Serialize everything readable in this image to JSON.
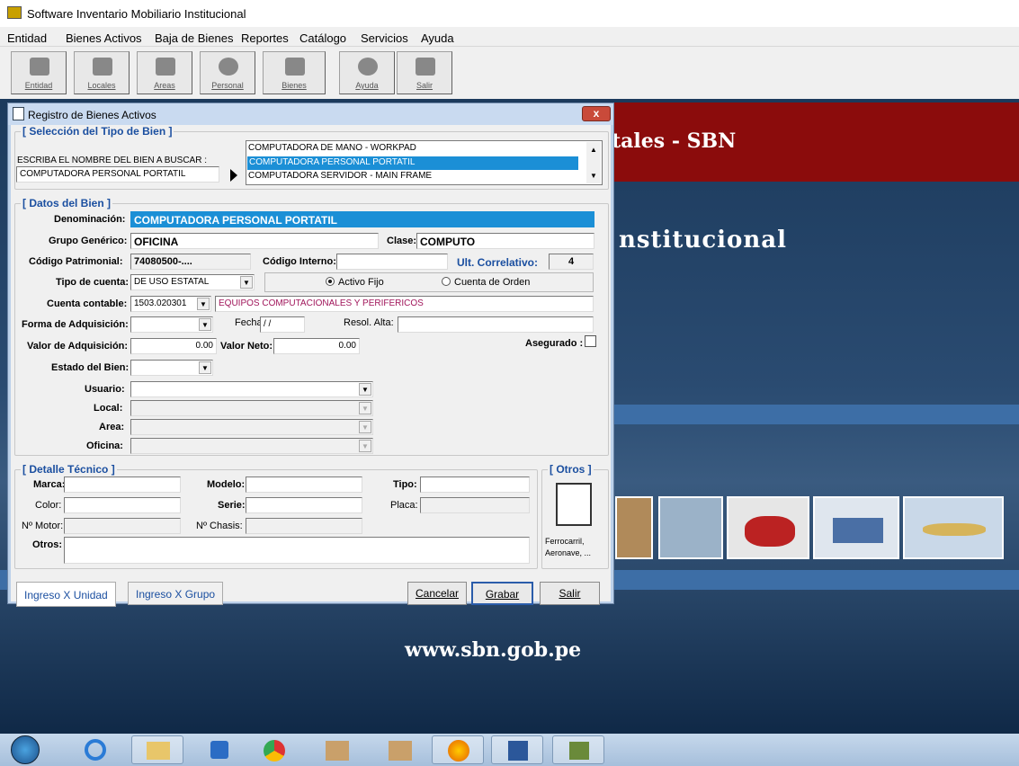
{
  "app": {
    "title": "Software Inventario Mobiliario Institucional"
  },
  "menu": [
    "Entidad",
    "Bienes Activos",
    "Baja de Bienes",
    "Reportes",
    "Catálogo",
    "Servicios",
    "Ayuda"
  ],
  "toolbar": [
    "Entidad",
    "Locales",
    "Areas",
    "Personal",
    "Bienes",
    "Ayuda",
    "Salir"
  ],
  "background": {
    "banner_title": "tales - SBN",
    "subtitle": "nstitucional",
    "url": "www.sbn.gob.pe"
  },
  "dialog": {
    "title": "Registro de Bienes Activos",
    "close": "x",
    "sec_tipo": "[ Selección del Tipo de Bien ]",
    "search_label": "ESCRIBA EL NOMBRE DEL BIEN A BUSCAR :",
    "search_value": "COMPUTADORA PERSONAL PORTATIL",
    "list": [
      "COMPUTADORA DE MANO - WORKPAD",
      "COMPUTADORA PERSONAL PORTATIL",
      "COMPUTADORA SERVIDOR - MAIN FRAME"
    ],
    "sec_datos": "[ Datos del Bien ]",
    "denominacion_label": "Denominación:",
    "denominacion": "COMPUTADORA PERSONAL PORTATIL",
    "grupo_label": "Grupo Genérico:",
    "grupo": "OFICINA",
    "clase_label": "Clase:",
    "clase": "COMPUTO",
    "codpat_label": "Código Patrimonial:",
    "codpat": "74080500-....",
    "codint_label": "Código Interno:",
    "ultcorr_label": "Ult. Correlativo:",
    "ultcorr": "4",
    "tipocuenta_label": "Tipo de cuenta:",
    "tipocuenta": "DE USO ESTATAL",
    "activo_fijo": "Activo Fijo",
    "cuenta_orden": "Cuenta de Orden",
    "cuentacont_label": "Cuenta contable:",
    "cuentacont": "1503.020301",
    "cuentacont_desc": "EQUIPOS COMPUTACIONALES Y PERIFERICOS",
    "forma_label": "Forma de Adquisición:",
    "fecha_label": "Fecha:",
    "fecha": " / /",
    "resol_label": "Resol. Alta:",
    "valoradq_label": "Valor de Adquisición:",
    "valoradq": "0.00",
    "valorneto_label": "Valor Neto:",
    "valorneto": "0.00",
    "asegurado_label": "Asegurado  :",
    "estado_label": "Estado del Bien:",
    "usuario_label": "Usuario:",
    "local_label": "Local:",
    "area_label": "Area:",
    "oficina_label": "Oficina:",
    "sec_detalle": "[ Detalle Técnico ]",
    "marca_label": "Marca:",
    "modelo_label": "Modelo:",
    "tipo_label": "Tipo:",
    "color_label": "Color:",
    "serie_label": "Serie:",
    "placa_label": "Placa:",
    "motor_label": "Nº Motor:",
    "chasis_label": "Nº Chasis:",
    "otros_label": "Otros:",
    "sec_otros": "[ Otros ]",
    "otros_caption1": "Ferrocarril,",
    "otros_caption2": "Aeronave, ...",
    "tab_unidad": "Ingreso X Unidad",
    "tab_grupo": "Ingreso X Grupo",
    "cancelar": "Cancelar",
    "grabar": "Grabar",
    "salir": "Salir"
  },
  "colors": {
    "accent": "#1b8fd6",
    "banner": "#8b0c0c",
    "legend": "#1b4fa0"
  }
}
